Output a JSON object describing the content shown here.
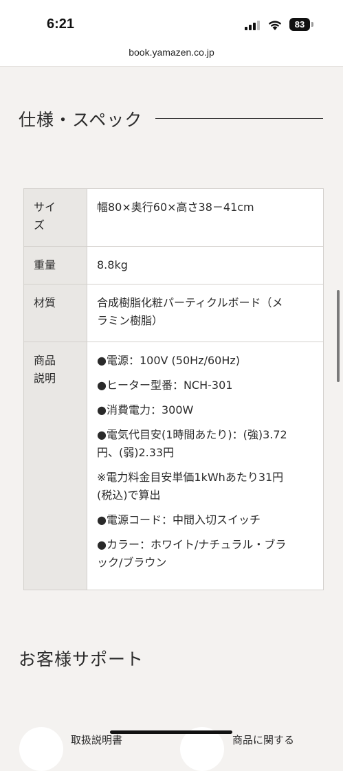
{
  "status_bar": {
    "time": "6:21",
    "battery": "83"
  },
  "browser": {
    "url": "book.yamazen.co.jp"
  },
  "spec_section": {
    "heading": "仕様・スペック",
    "rows": [
      {
        "label": "サイ\nズ",
        "value_lines": [
          "幅80×奥行60×高さ38－41cm"
        ]
      },
      {
        "label": "重量",
        "value_lines": [
          "8.8kg"
        ]
      },
      {
        "label": "材質",
        "value_lines": [
          "合成樹脂化粧パーティクルボード（メ\nラミン樹脂）"
        ]
      },
      {
        "label": "商品\n説明",
        "value_lines": [
          "●電源：100V (50Hz/60Hz)",
          "●ヒーター型番：NCH-301",
          "●消費電力：300W",
          "●電気代目安(1時間あたり)：(強)3.72\n円、(弱)2.33円",
          "※電力料金目安単価1kWhあたり31円\n(税込)で算出",
          "●電源コード：中間入切スイッチ",
          "●カラー：ホワイト/ナチュラル・ブラ\nック/ブラウン"
        ]
      }
    ]
  },
  "support_section": {
    "heading": "お客様サポート",
    "items": [
      "取扱説明書",
      "商品に関する"
    ]
  }
}
